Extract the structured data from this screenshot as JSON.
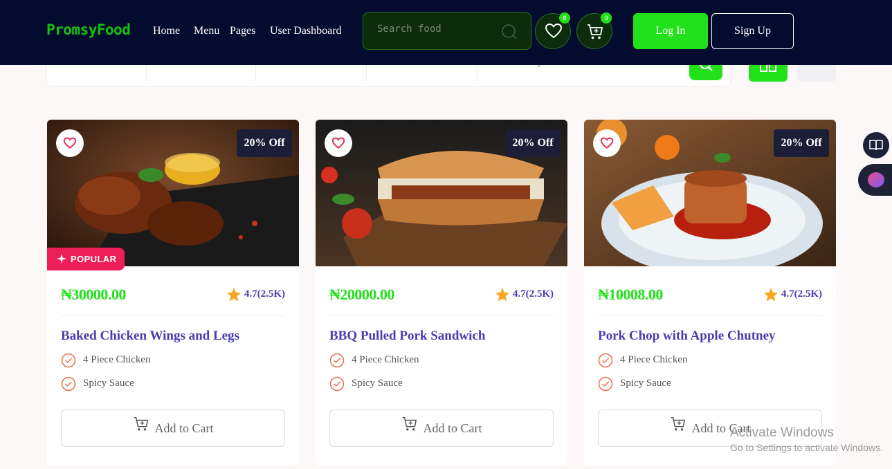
{
  "header": {
    "logo": "PromsyFood",
    "nav": [
      "Home",
      "Menu",
      "Pages",
      "User Dashboard"
    ],
    "search_placeholder": "Search food",
    "wishlist_count": "8",
    "cart_count": "3",
    "login_label": "Log In",
    "signup_label": "Sign Up"
  },
  "filter": {
    "keyword_placeholder": "Enter keyword here"
  },
  "cards": [
    {
      "price": "₦30000.00",
      "rating": "4.7(2.5K)",
      "discount": "20% Off",
      "popular": "POPULAR",
      "title": "Baked Chicken Wings and Legs",
      "features": [
        "4 Piece Chicken",
        "Spicy Sauce"
      ],
      "cart_label": "Add to Cart"
    },
    {
      "price": "₦20000.00",
      "rating": "4.7(2.5K)",
      "discount": "20% Off",
      "title": "BBQ Pulled Pork Sandwich",
      "features": [
        "4 Piece Chicken",
        "Spicy Sauce"
      ],
      "cart_label": "Add to Cart"
    },
    {
      "price": "₦10008.00",
      "rating": "4.7(2.5K)",
      "discount": "20% Off",
      "title": "Pork Chop with Apple Chutney",
      "features": [
        "4 Piece Chicken",
        "Spicy Sauce"
      ],
      "cart_label": "Add to Cart"
    }
  ],
  "watermark": {
    "line1": "Activate Windows",
    "line2": "Go to Settings to activate Windows."
  },
  "colors": {
    "brand_green": "#22e11a",
    "header_bg": "#030b2e",
    "title_purple": "#4a3cb0",
    "popular_red": "#ee1e58"
  }
}
